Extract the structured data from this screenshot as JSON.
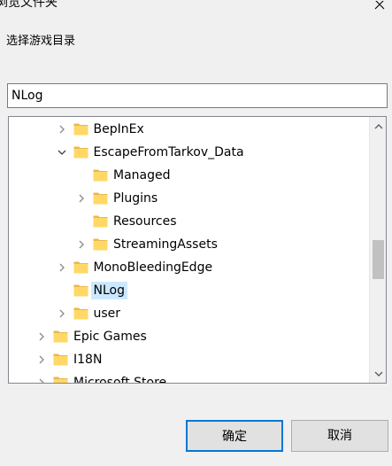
{
  "window": {
    "title": "浏览文件夹"
  },
  "dialog": {
    "prompt": "选择游戏目录",
    "path_value": "NLog",
    "ok_label": "确定",
    "cancel_label": "取消"
  },
  "tree": {
    "items": [
      {
        "label": "BepInEx",
        "expander": "collapsed",
        "selected": false
      },
      {
        "label": "EscapeFromTarkov_Data",
        "expander": "expanded",
        "selected": false
      },
      {
        "label": "Managed",
        "expander": "none",
        "selected": false
      },
      {
        "label": "Plugins",
        "expander": "collapsed",
        "selected": false
      },
      {
        "label": "Resources",
        "expander": "none",
        "selected": false
      },
      {
        "label": "StreamingAssets",
        "expander": "collapsed",
        "selected": false
      },
      {
        "label": "MonoBleedingEdge",
        "expander": "collapsed",
        "selected": false
      },
      {
        "label": "NLog",
        "expander": "none",
        "selected": true
      },
      {
        "label": "user",
        "expander": "collapsed",
        "selected": false
      },
      {
        "label": "Epic Games",
        "expander": "collapsed",
        "selected": false
      },
      {
        "label": "I18N",
        "expander": "collapsed",
        "selected": false
      },
      {
        "label": "Microsoft Store",
        "expander": "collapsed",
        "selected": false
      }
    ]
  },
  "icons": {
    "close": "close-icon",
    "folder": "folder-icon",
    "expander_collapsed": "chevron-right-icon",
    "expander_expanded": "chevron-down-icon",
    "scroll_up": "scroll-up-arrow-icon",
    "scroll_down": "scroll-down-arrow-icon"
  },
  "colors": {
    "accent": "#0078d7",
    "selection": "#cce8ff",
    "folder": "#ffd866",
    "folder_dark": "#e9b949"
  }
}
